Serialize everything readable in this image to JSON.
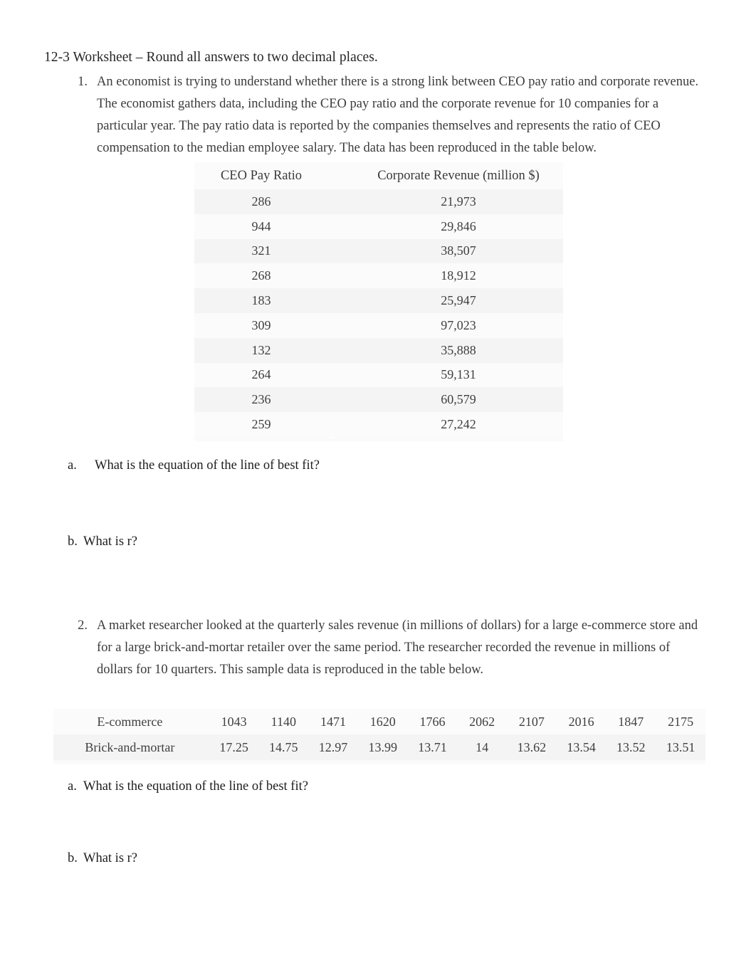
{
  "document": {
    "title": "12-3 Worksheet – Round all answers to two decimal places."
  },
  "questions": [
    {
      "number": "1.",
      "text": "An economist is trying to understand whether there is a strong link between CEO pay ratio and corporate revenue. The economist gathers data, including the CEO pay ratio and the corporate revenue for 10 companies for a particular year. The pay ratio data is reported by the companies themselves and represents the ratio of CEO compensation to the median employee salary. The data has been reproduced in the table below.",
      "sub_items": [
        {
          "letter": "a.",
          "text": "What is the equation of the line of best fit?"
        },
        {
          "letter": "b.",
          "text": "What is r?"
        }
      ]
    },
    {
      "number": "2.",
      "text": "A market researcher looked at the quarterly sales revenue (in millions of dollars) for a large e-commerce store and for a large brick-and-mortar retailer over the same period. The researcher recorded the revenue in millions of dollars for 10 quarters. This sample data is reproduced in the table below.",
      "sub_items": [
        {
          "letter": "a.",
          "text": "What is the equation of the line of best fit?"
        },
        {
          "letter": "b.",
          "text": "What is r?"
        }
      ]
    }
  ],
  "table_ceo": {
    "headers": [
      "CEO Pay Ratio",
      "Corporate Revenue (million $)"
    ],
    "rows": [
      [
        "286",
        "21,973"
      ],
      [
        "944",
        "29,846"
      ],
      [
        "321",
        "38,507"
      ],
      [
        "268",
        "18,912"
      ],
      [
        "183",
        "25,947"
      ],
      [
        "309",
        "97,023"
      ],
      [
        "132",
        "35,888"
      ],
      [
        "264",
        "59,131"
      ],
      [
        "236",
        "60,579"
      ],
      [
        "259",
        "27,242"
      ]
    ]
  },
  "table_quarters": {
    "rows": [
      {
        "label": "E-commerce",
        "values": [
          "1043",
          "1140",
          "1471",
          "1620",
          "1766",
          "2062",
          "2107",
          "2016",
          "1847",
          "2175"
        ]
      },
      {
        "label": "Brick-and-mortar",
        "values": [
          "17.25",
          "14.75",
          "12.97",
          "13.99",
          "13.71",
          "14",
          "13.62",
          "13.54",
          "13.52",
          "13.51"
        ]
      }
    ]
  }
}
